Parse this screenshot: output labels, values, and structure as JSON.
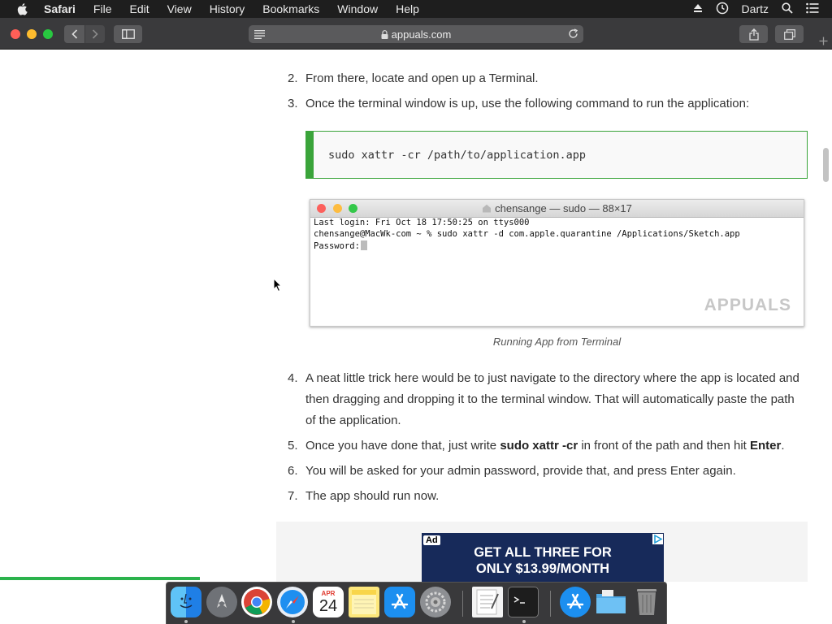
{
  "menubar": {
    "app_name": "Safari",
    "items": [
      "File",
      "Edit",
      "View",
      "History",
      "Bookmarks",
      "Window",
      "Help"
    ],
    "user": "Dartz"
  },
  "toolbar": {
    "url": "appuals.com"
  },
  "article": {
    "step2": {
      "num": "2.",
      "text": "From there, locate and open up a Terminal."
    },
    "step3": {
      "num": "3.",
      "text": "Once the terminal window is up, use the following command to run the application:"
    },
    "code": "sudo xattr -cr /path/to/application.app",
    "terminal": {
      "title": "chensange — sudo — 88×17",
      "line1": "Last login: Fri Oct 18 17:50:25 on ttys000",
      "line2": "chensange@MacWk-com ~ % sudo xattr -d com.apple.quarantine /Applications/Sketch.app",
      "line3": "Password:",
      "watermark": "APPUALS"
    },
    "caption": "Running App from Terminal",
    "step4": {
      "num": "4.",
      "text": "A neat little trick here would be to just navigate to the directory where the app is located and then dragging and dropping it to the terminal window. That will automatically paste the path of the application."
    },
    "step5": {
      "num": "5.",
      "pre": "Once you have done that, just write ",
      "bold1": "sudo xattr -cr",
      "mid": " in front of the path and then hit ",
      "bold2": "Enter",
      "post": "."
    },
    "step6": {
      "num": "6.",
      "text": "You will be asked for your admin password, provide that, and press Enter again."
    },
    "step7": {
      "num": "7.",
      "text": "The app should run now."
    }
  },
  "ad": {
    "label": "Ad",
    "line1": "GET ALL THREE FOR",
    "line2": "ONLY $13.99/MONTH"
  },
  "dock": {
    "calendar_month": "APR",
    "calendar_day": "24",
    "apps": [
      "finder-icon",
      "launchpad-icon",
      "chrome-icon",
      "safari-icon",
      "calendar-icon",
      "notes-icon",
      "app-store-icon",
      "system-preferences-icon",
      "textedit-icon",
      "terminal-icon",
      "app-store-folder-icon",
      "folder-icon",
      "trash-icon"
    ]
  },
  "colors": {
    "accent_green": "#3aa43a",
    "ad_background": "#172a5a"
  }
}
